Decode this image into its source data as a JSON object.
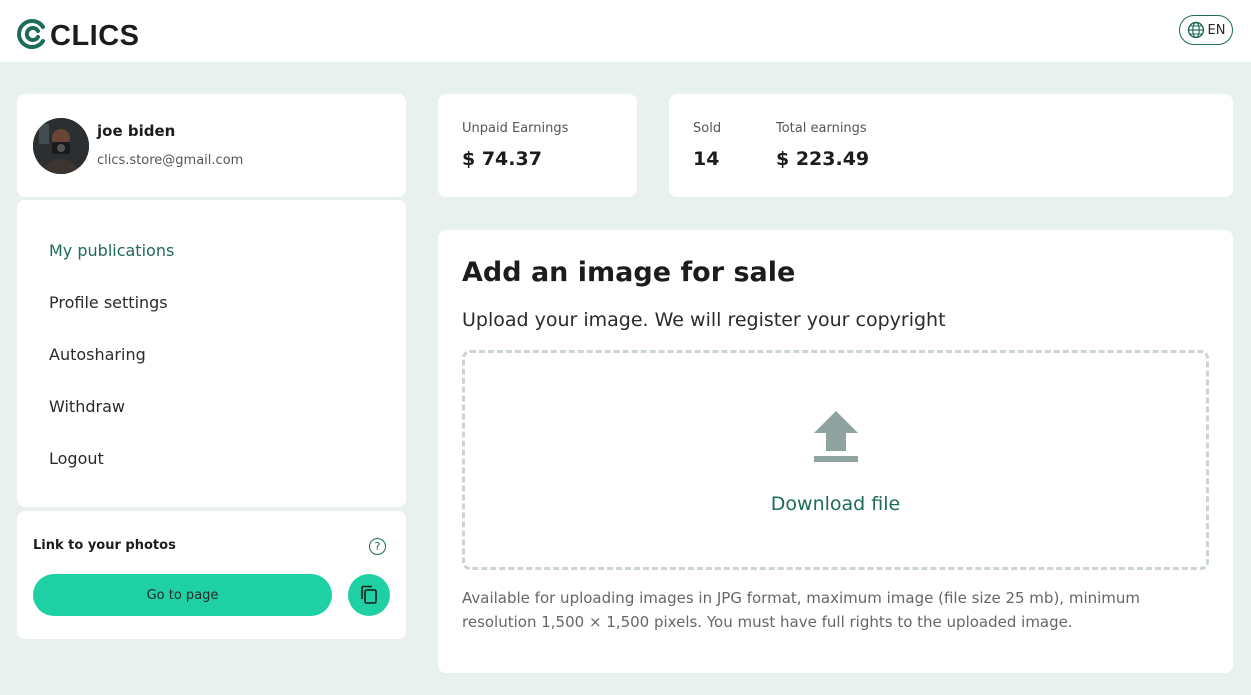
{
  "header": {
    "logo_text": "CLICS",
    "lang_label": "EN"
  },
  "profile": {
    "name": "joe biden",
    "email": "clics.store@gmail.com"
  },
  "menu": {
    "items": [
      {
        "label": "My publications",
        "active": true
      },
      {
        "label": "Profile settings",
        "active": false
      },
      {
        "label": "Autosharing",
        "active": false
      },
      {
        "label": "Withdraw",
        "active": false
      },
      {
        "label": "Logout",
        "active": false
      }
    ]
  },
  "link_card": {
    "title": "Link to your photos",
    "help": "?",
    "button_label": "Go to page"
  },
  "stats": {
    "unpaid_label": "Unpaid Earnings",
    "unpaid_value": "$ 74.37",
    "sold_label": "Sold",
    "sold_value": "14",
    "total_label": "Total earnings",
    "total_value": "$ 223.49"
  },
  "upload": {
    "title": "Add an image for sale",
    "subtitle": "Upload your image. We will register your copyright",
    "dropzone_label": "Download file",
    "note": "Available for uploading images in JPG format, maximum image (file size 25 mb), minimum resolution 1,500 × 1,500 pixels. You must have full rights to the uploaded image."
  },
  "colors": {
    "brand": "#1d6b5a",
    "accent": "#1fd0a4",
    "background": "#e9f1ee",
    "upload_icon": "#8fa3a1"
  },
  "icons": {
    "logo": "clics-logo-icon",
    "globe": "globe-icon",
    "help": "help-icon",
    "copy": "copy-icon",
    "upload": "upload-icon"
  }
}
